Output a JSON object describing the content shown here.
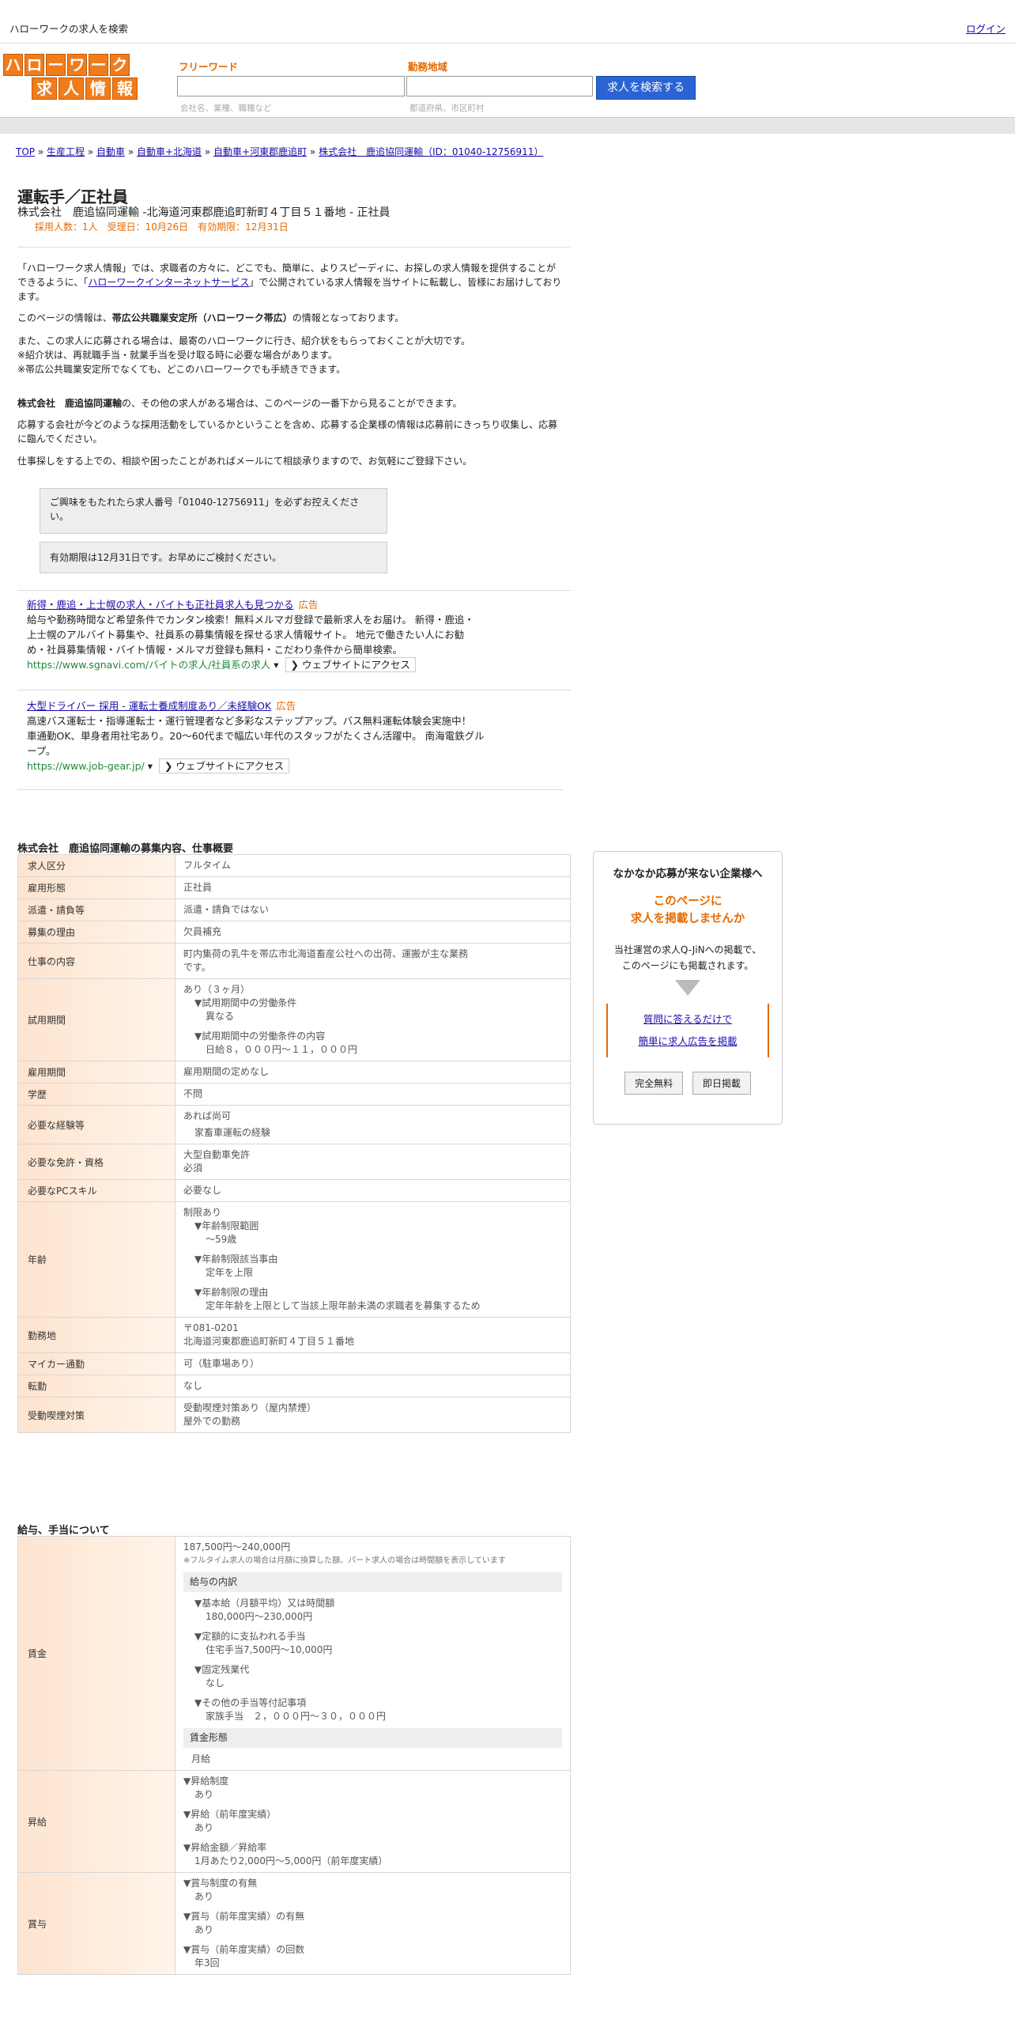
{
  "topbar": {
    "title": "ハローワークの求人を検索",
    "login": "ログイン"
  },
  "logo": {
    "row1": [
      "ハ",
      "ロ",
      "ー",
      "ワ",
      "ー",
      "ク"
    ],
    "row2": [
      "求",
      "人",
      "情",
      "報"
    ]
  },
  "search": {
    "free_label": "フリーワード",
    "free_hint": "会社名、業種、職種など",
    "area_label": "勤務地域",
    "area_hint": "都道府県、市区町村",
    "button": "求人を検索する"
  },
  "breadcrumb": [
    "TOP",
    "生産工程",
    "自動車",
    "自動車+北海道",
    "自動車+河東郡鹿追町",
    "株式会社　鹿追協同運輸（ID：01040-12756911）"
  ],
  "job": {
    "title": "運転手／正社員",
    "subtitle": "株式会社　鹿追協同運輸 -北海道河東郡鹿追町新町４丁目５１番地 - 正社員",
    "meta": "採用人数：1人　受理日：10月26日　有効期限：12月31日"
  },
  "intro": {
    "p1a": "「ハローワーク求人情報」では、求職者の方々に、どこでも、簡単に、よりスピーディに、お探しの求人情報を提供することができるように、「",
    "p1link": "ハローワークインターネットサービス",
    "p1b": "」で公開されている求人情報を当サイトに転載し、皆様にお届けしております。",
    "p2a": "このページの情報は、",
    "p2b": "帯広公共職業安定所（ハローワーク帯広）",
    "p2c": "の情報となっております。",
    "p3": [
      "また、この求人に応募される場合は、最寄のハローワークに行き、紹介状をもらっておくことが大切です。",
      "※紹介状は、再就職手当・就業手当を受け取る時に必要な場合があります。",
      "※帯広公共職業安定所でなくても、どこのハローワークでも手続きできます。"
    ],
    "p4a": "株式会社　鹿追協同運輸",
    "p4b": "の、その他の求人がある場合は、このページの一番下から見ることができます。",
    "p5": "応募する会社が今どのような採用活動をしているかということを含め、応募する企業様の情報は応募前にきっちり収集し、応募に臨んでください。",
    "p6": "仕事探しをする上での、相談や困ったことがあればメールにて相談承りますので、お気軽にご登録下さい。"
  },
  "notices": [
    "ご興味をもたれたら求人番号「01040-12756911」を必ずお控えください。",
    "有効期限は12月31日です。お早めにご検討ください。"
  ],
  "ads": [
    {
      "headline": "新得・鹿追・上士幌の求人・バイトも正社員求人も見つかる",
      "label": "広告",
      "body": [
        "給与や勤務時間など希望条件でカンタン検索！無料メルマガ登録で最新求人をお届け。 新得・鹿追・",
        "上士幌のアルバイト募集や、社員系の募集情報を探せる求人情報サイト。 地元で働きたい人にお勧",
        "め・社員募集情報・バイト情報・メルマガ登録も無料・こだわり条件から簡単検索。"
      ],
      "url": "https://www.sgnavi.com/バイトの求人/社員系の求人",
      "visit": "❯ ウェブサイトにアクセス"
    },
    {
      "headline": "大型ドライバー 採用 - 運転士養成制度あり／未経験OK",
      "label": "広告",
      "body": [
        "高速バス運転士・指導運転士・運行管理者など多彩なステップアップ。バス無料運転体験会実施中！",
        "車通勤OK、単身者用社宅あり。20～60代まで幅広い年代のスタッフがたくさん活躍中。 南海電鉄グル",
        "ープ。"
      ],
      "url": "https://www.job-gear.jp/",
      "visit": "❯ ウェブサイトにアクセス"
    }
  ],
  "section1": "株式会社　鹿追協同運輸の募集内容、仕事概要",
  "rows": {
    "r1": [
      "求人区分",
      "フルタイム"
    ],
    "r2": [
      "雇用形態",
      "正社員"
    ],
    "r3": [
      "派遣・請負等",
      "派遣・請負ではない"
    ],
    "r4": [
      "募集の理由",
      "欠員補充"
    ],
    "r5": [
      "仕事の内容",
      "町内集荷の乳牛を帯広市北海道畜産公社への出荷、運搬が主な業務",
      "です。"
    ],
    "r6": [
      "試用期間",
      "あり（３ヶ月）",
      "▼試用期間中の労働条件",
      "異なる",
      "▼試用期間中の労働条件の内容",
      "日給８，０００円～１１，０００円"
    ],
    "r7": [
      "雇用期間",
      "雇用期間の定めなし"
    ],
    "r8": [
      "学歴",
      "不問"
    ],
    "r9": [
      "必要な経験等",
      "あれば尚可",
      "家畜車運転の経験"
    ],
    "r10": [
      "必要な免許・資格",
      "大型自動車免許",
      "必須"
    ],
    "r11": [
      "必要なPCスキル",
      "必要なし"
    ],
    "r12": [
      "年齢",
      "制限あり",
      "▼年齢制限範囲",
      "～59歳",
      "▼年齢制限該当事由",
      "定年を上限",
      "▼年齢制限の理由",
      "定年年齢を上限として当該上限年齢未満の求職者を募集するため"
    ],
    "r13": [
      "勤務地",
      "〒081-0201",
      "北海道河東郡鹿追町新町４丁目５１番地"
    ],
    "r14": [
      "マイカー通勤",
      "可（駐車場あり）"
    ],
    "r15": [
      "転勤",
      "なし"
    ],
    "r16": [
      "受動喫煙対策",
      "受動喫煙対策あり（屋内禁煙）",
      "屋外での勤務"
    ]
  },
  "section2": "給与、手当について",
  "pay": {
    "wage_h": "賃金",
    "wage_amount": "187,500円〜240,000円",
    "wage_note": "※フルタイム求人の場合は月額に換算した額、パート求人の場合は時間額を表示しています",
    "breakdown_h": "給与の内訳",
    "items": [
      "▼基本給（月額平均）又は時間額",
      "180,000円〜230,000円",
      "▼定額的に支払われる手当",
      "住宅手当7,500円〜10,000円",
      "▼固定残業代",
      "なし",
      "▼その他の手当等付記事項",
      "家族手当　２，０００円～３０，０００円"
    ],
    "form_h": "賃金形態",
    "form": "月給",
    "raise_h": "昇給",
    "raise": [
      "▼昇給制度",
      "あり",
      "▼昇給（前年度実績）",
      "あり",
      "▼昇給金額／昇給率",
      "1月あたり2,000円〜5,000円（前年度実績）"
    ],
    "bonus_h": "賞与",
    "bonus": [
      "▼賞与制度の有無",
      "あり",
      "▼賞与（前年度実績）の有無",
      "あり",
      "▼賞与（前年度実績）の回数",
      "年3回"
    ]
  },
  "side": {
    "title": "なかなか応募が来ない企業様へ",
    "catch1": "このページに",
    "catch2": "求人を掲載しませんか",
    "desc1": "当社運営の求人Q-JiNへの掲載で、",
    "desc2": "このページにも掲載されます。",
    "link1": "質問に答えるだけで",
    "link2": "簡単に求人広告を掲載",
    "btn1": "完全無料",
    "btn2": "即日掲載"
  }
}
